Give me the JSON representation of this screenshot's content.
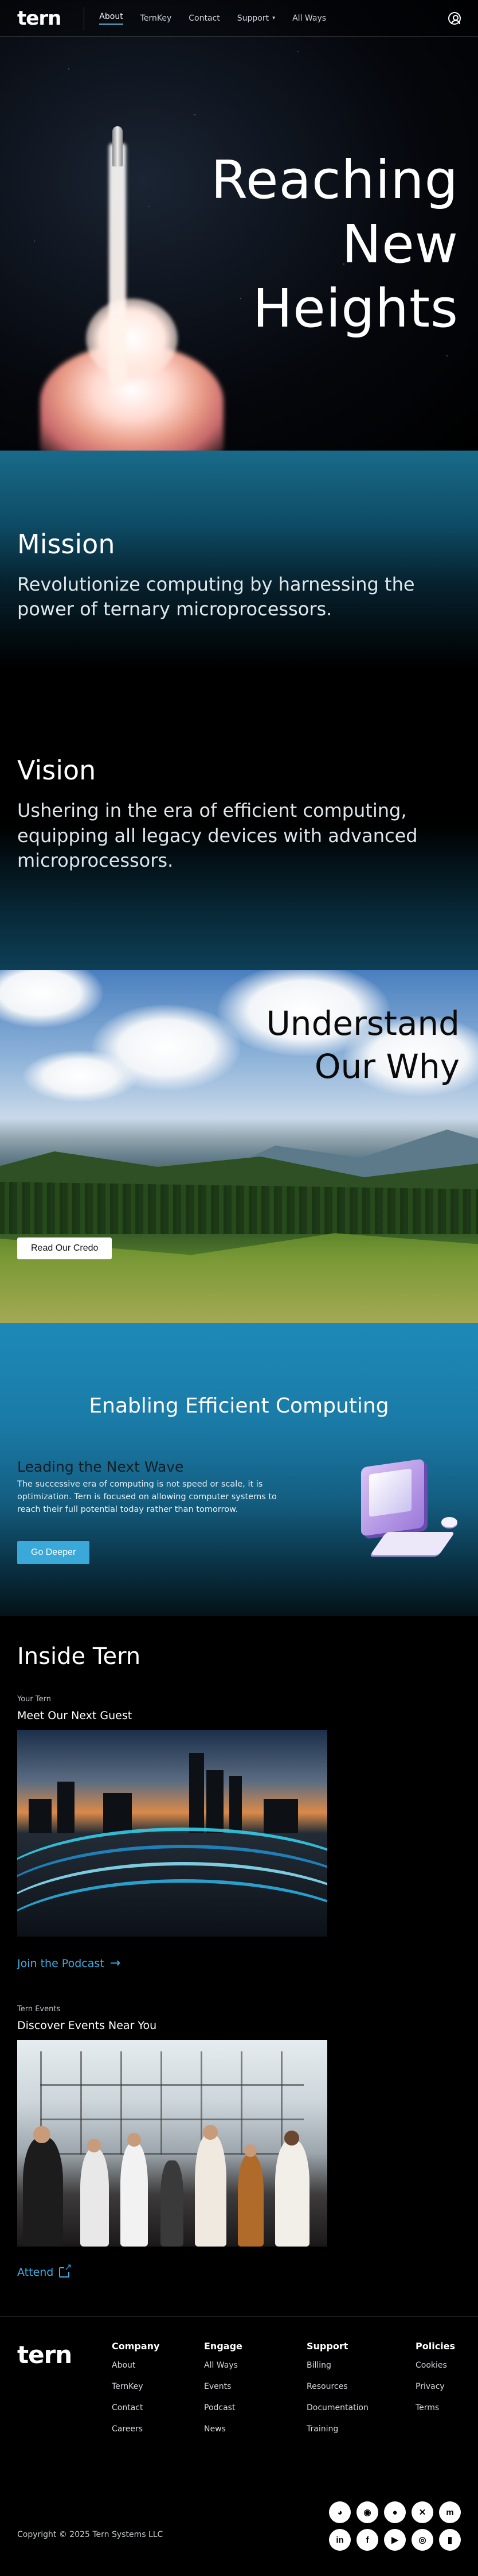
{
  "nav": {
    "logo": "tern",
    "links": [
      "About",
      "TernKey",
      "Contact",
      "Support",
      "All Ways"
    ]
  },
  "hero": {
    "title_lines": [
      "Reaching",
      "New",
      "Heights"
    ]
  },
  "mission": {
    "heading": "Mission",
    "text": "Revolutionize computing by harnessing the power of ternary microprocessors."
  },
  "vision": {
    "heading": "Vision",
    "text": "Ushering in the era of efficient computing, equipping all legacy devices with advanced microprocessors."
  },
  "why": {
    "title_lines": [
      "Understand",
      "Our Why"
    ],
    "button": "Read Our Credo"
  },
  "efficient": {
    "heading": "Enabling Efficient Computing",
    "subheading": "Leading the Next Wave",
    "text": "The successive era of computing is not speed or scale, it is optimization. Tern is focused on allowing computer systems to reach their full potential today rather than tomorrow.",
    "button": "Go Deeper"
  },
  "inside": {
    "heading": "Inside Tern",
    "cards": [
      {
        "kicker": "Your Tern",
        "title": "Meet Our Next Guest",
        "link": "Join the Podcast"
      },
      {
        "kicker": "Tern Events",
        "title": "Discover Events Near You",
        "link": "Attend"
      }
    ]
  },
  "footer": {
    "logo": "tern",
    "columns": [
      {
        "heading": "Company",
        "links": [
          "About",
          "TernKey",
          "Contact",
          "Careers"
        ]
      },
      {
        "heading": "Engage",
        "links": [
          "All Ways",
          "Events",
          "Podcast",
          "News"
        ]
      },
      {
        "heading": "Support",
        "links": [
          "Billing",
          "Resources",
          "Documentation",
          "Training"
        ]
      },
      {
        "heading": "Policies",
        "links": [
          "Cookies",
          "Privacy",
          "Terms"
        ]
      }
    ],
    "copyright": "Copyright © 2025 Tern Systems LLC",
    "socials": [
      "discord-icon",
      "reddit-icon",
      "github-icon",
      "x-icon",
      "mastodon-icon",
      "linkedin-icon",
      "facebook-icon",
      "youtube-icon",
      "instagram-icon",
      "twitch-icon"
    ]
  }
}
